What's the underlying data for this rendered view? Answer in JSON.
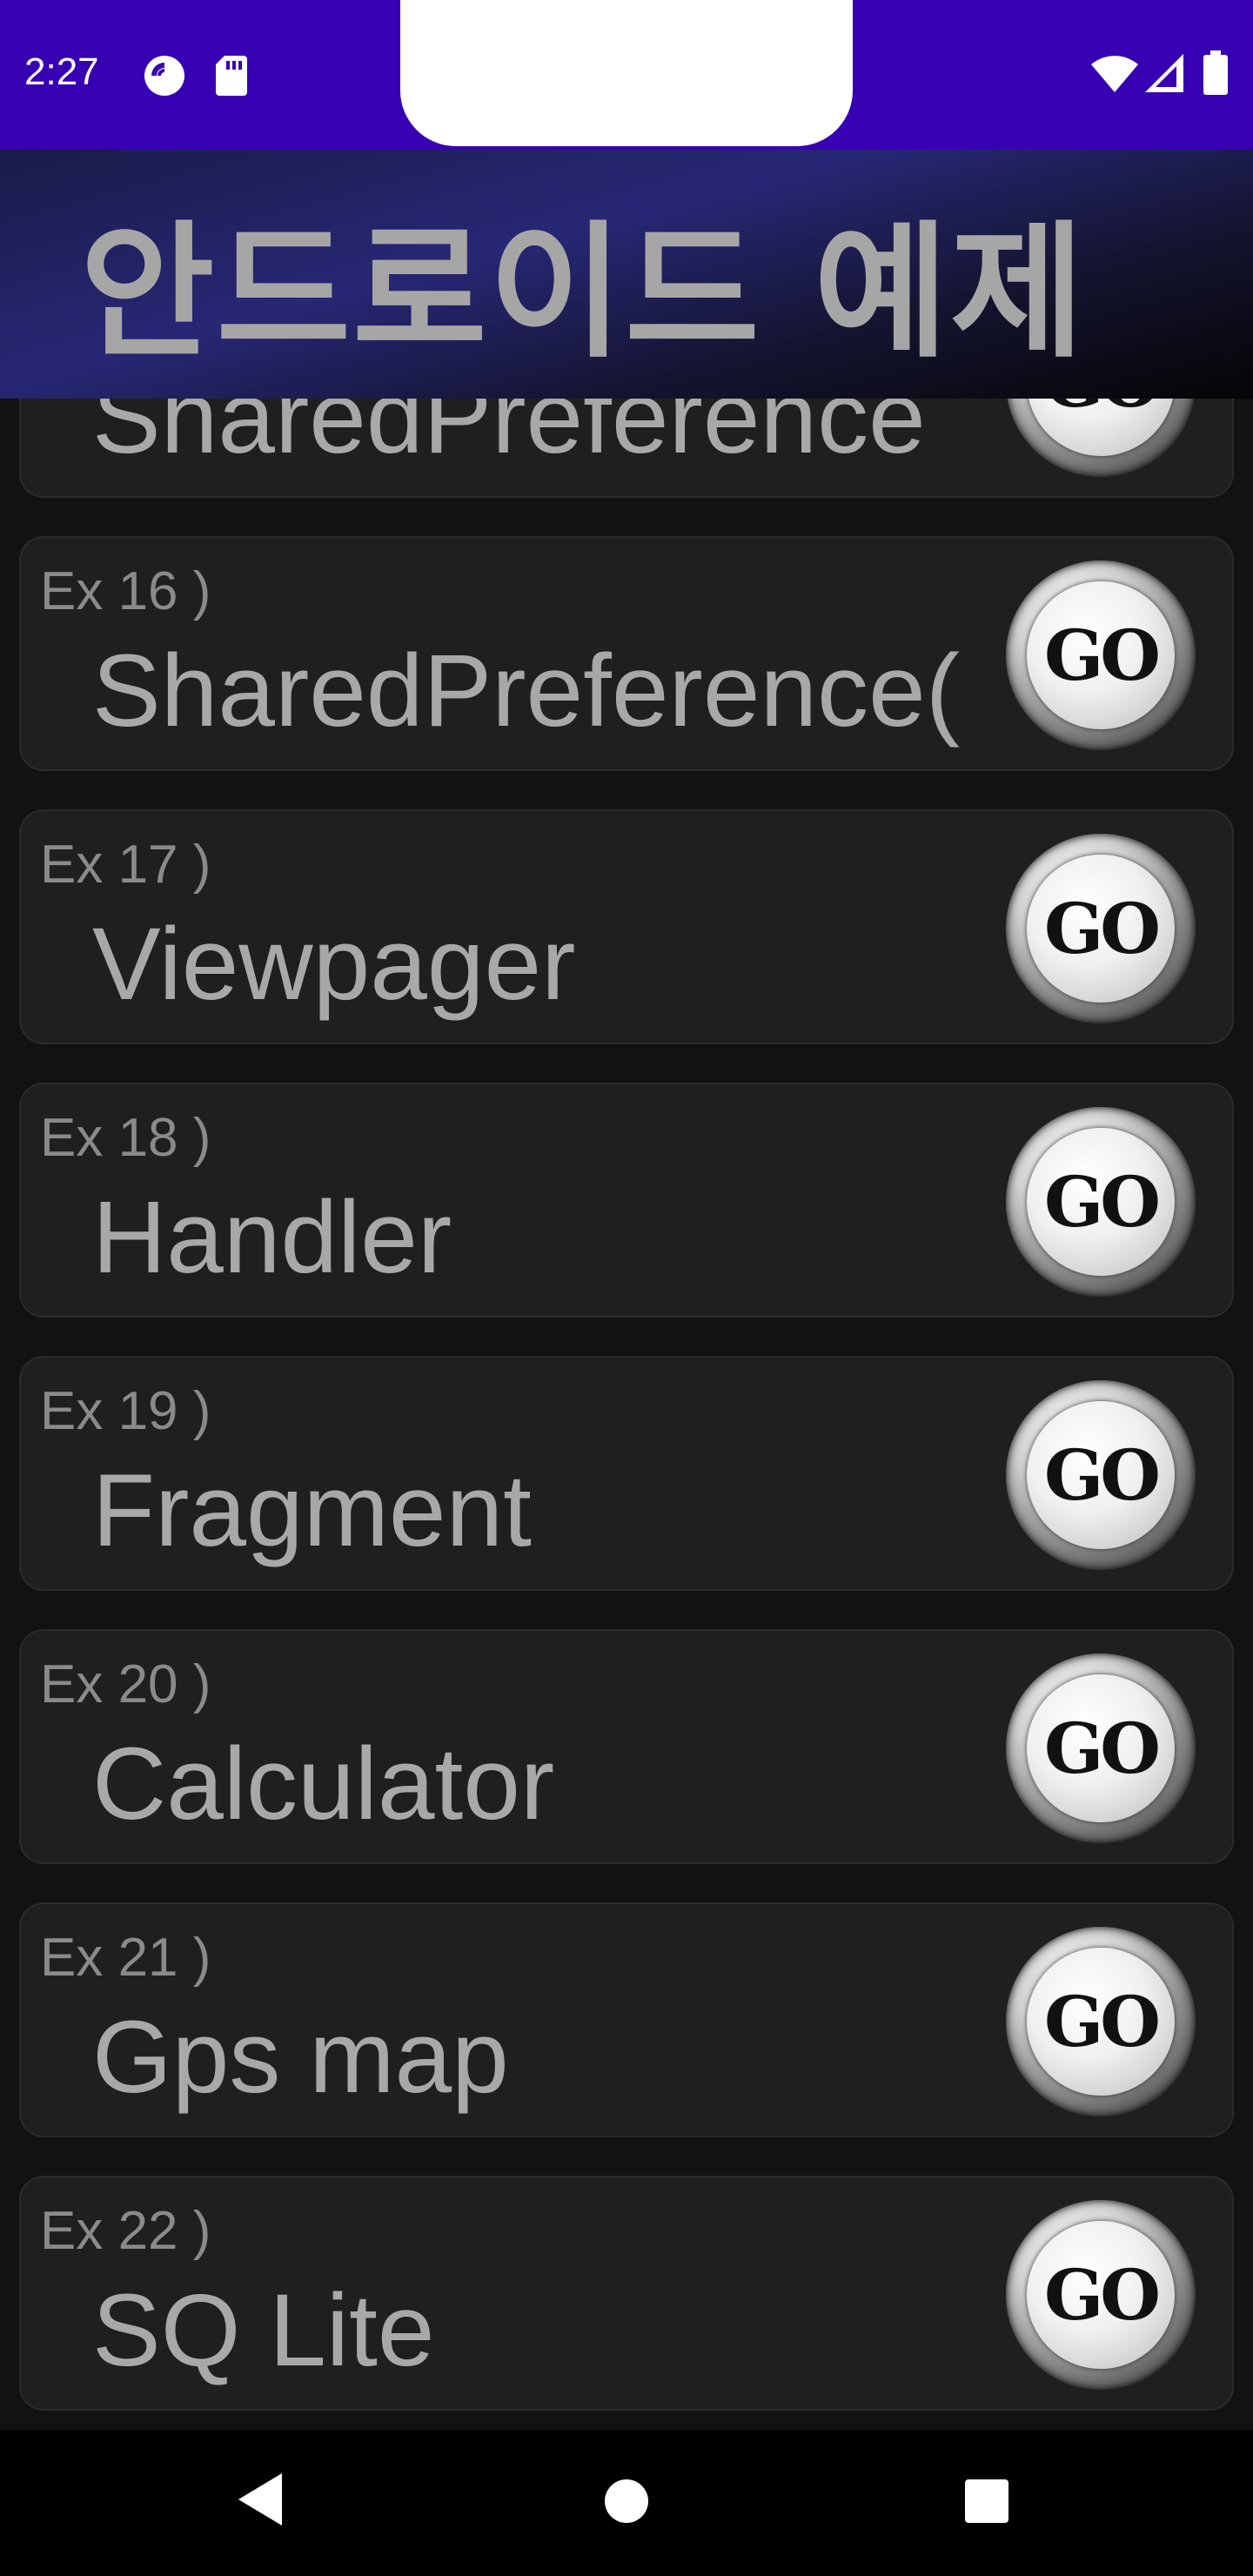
{
  "status_bar": {
    "time": "2:27",
    "icons_left": [
      "pocket-casts-icon",
      "sd-card-icon"
    ],
    "icons_right": [
      "wifi-icon",
      "cellular-signal-icon",
      "battery-icon"
    ],
    "color": "#3700b3"
  },
  "header": {
    "title": "안드로이드 예제"
  },
  "list": {
    "items": [
      {
        "index": "",
        "title": "SharedPreference",
        "button": "GO"
      },
      {
        "index": "Ex 16 )",
        "title": "SharedPreference(",
        "button": "GO"
      },
      {
        "index": "Ex 17 )",
        "title": "Viewpager",
        "button": "GO"
      },
      {
        "index": "Ex 18 )",
        "title": "Handler",
        "button": "GO"
      },
      {
        "index": "Ex 19 )",
        "title": "Fragment",
        "button": "GO"
      },
      {
        "index": "Ex 20 )",
        "title": "Calculator",
        "button": "GO"
      },
      {
        "index": "Ex 21 )",
        "title": "Gps map",
        "button": "GO"
      },
      {
        "index": "Ex 22 )",
        "title": "SQ Lite",
        "button": "GO"
      }
    ]
  },
  "nav_bar": {
    "icons": [
      "back-icon",
      "home-icon",
      "recents-icon"
    ]
  }
}
